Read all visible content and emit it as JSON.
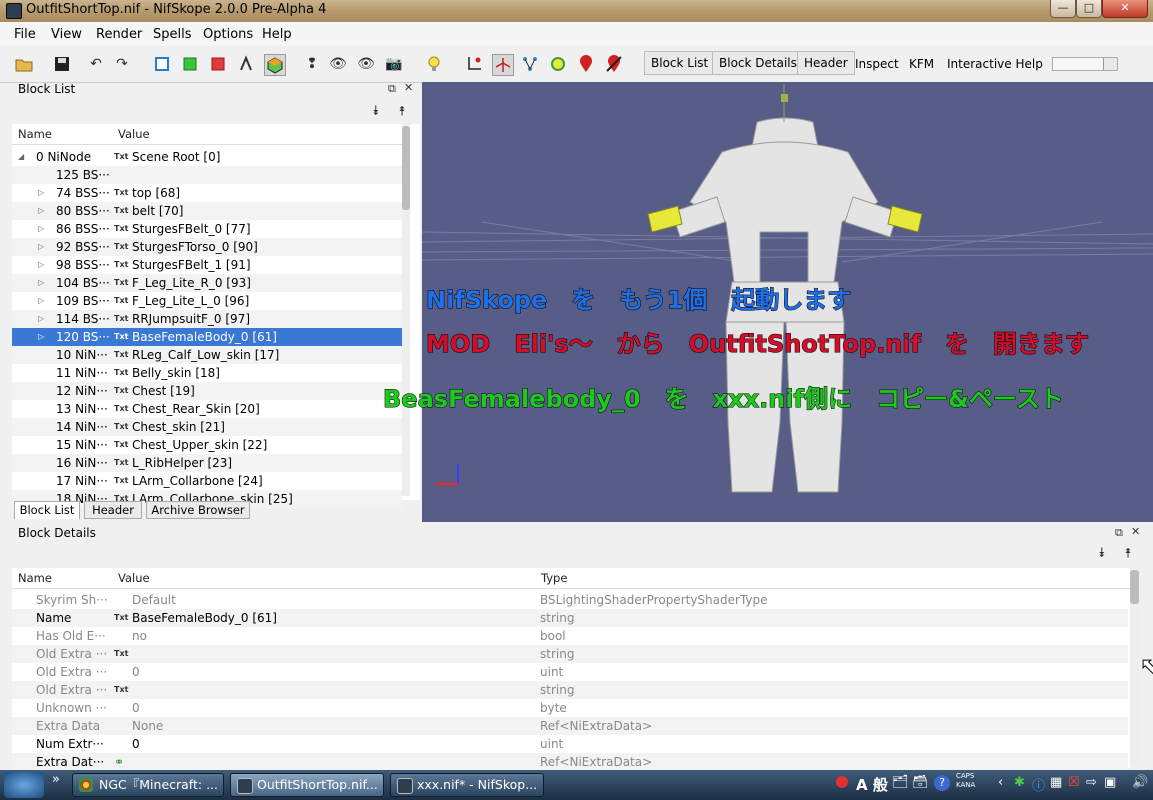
{
  "window": {
    "title": "OutfitShortTop.nif - NifSkope 2.0.0 Pre-Alpha 4",
    "minimize": "—",
    "maximize": "□",
    "close": "✕"
  },
  "menu": [
    "File",
    "View",
    "Render",
    "Spells",
    "Options",
    "Help"
  ],
  "toolbar": {
    "buttons": [
      "Block List",
      "Block Details",
      "Header",
      "Inspect",
      "KFM",
      "Interactive Help"
    ]
  },
  "block_list": {
    "title": "Block List",
    "columns": [
      "Name",
      "Value"
    ],
    "rows": [
      {
        "name": "0 NiNode",
        "value": "Scene Root [0]",
        "txt": true,
        "arrow": "◢"
      },
      {
        "name": "125 BS···",
        "value": "",
        "txt": false,
        "arrow": ""
      },
      {
        "name": "74 BSS···",
        "value": "top [68]",
        "txt": true,
        "arrow": "▷"
      },
      {
        "name": "80 BSS···",
        "value": "belt [70]",
        "txt": true,
        "arrow": "▷"
      },
      {
        "name": "86 BSS···",
        "value": "SturgesFBelt_0 [77]",
        "txt": true,
        "arrow": "▷"
      },
      {
        "name": "92 BSS···",
        "value": "SturgesFTorso_0 [90]",
        "txt": true,
        "arrow": "▷"
      },
      {
        "name": "98 BSS···",
        "value": "SturgesFBelt_1 [91]",
        "txt": true,
        "arrow": "▷"
      },
      {
        "name": "104 BS···",
        "value": "F_Leg_Lite_R_0 [93]",
        "txt": true,
        "arrow": "▷"
      },
      {
        "name": "109 BS···",
        "value": "F_Leg_Lite_L_0 [96]",
        "txt": true,
        "arrow": "▷"
      },
      {
        "name": "114 BS···",
        "value": "RRJumpsuitF_0 [97]",
        "txt": true,
        "arrow": "▷"
      },
      {
        "name": "120 BS···",
        "value": "BaseFemaleBody_0 [61]",
        "txt": true,
        "arrow": "▷"
      },
      {
        "name": "10 NiN···",
        "value": "RLeg_Calf_Low_skin [17]",
        "txt": true,
        "arrow": ""
      },
      {
        "name": "11 NiN···",
        "value": "Belly_skin [18]",
        "txt": true,
        "arrow": ""
      },
      {
        "name": "12 NiN···",
        "value": "Chest [19]",
        "txt": true,
        "arrow": ""
      },
      {
        "name": "13 NiN···",
        "value": "Chest_Rear_Skin [20]",
        "txt": true,
        "arrow": ""
      },
      {
        "name": "14 NiN···",
        "value": "Chest_skin [21]",
        "txt": true,
        "arrow": ""
      },
      {
        "name": "15 NiN···",
        "value": "Chest_Upper_skin [22]",
        "txt": true,
        "arrow": ""
      },
      {
        "name": "16 NiN···",
        "value": "L_RibHelper [23]",
        "txt": true,
        "arrow": ""
      },
      {
        "name": "17 NiN···",
        "value": "LArm_Collarbone [24]",
        "txt": true,
        "arrow": ""
      },
      {
        "name": "18 NiN···",
        "value": "LArm_Collarbone_skin [25]",
        "txt": true,
        "arrow": ""
      }
    ],
    "selected_index": 10,
    "tabs": [
      "Block List",
      "Header",
      "Archive Browser"
    ]
  },
  "overlay": {
    "line1": "NifSkope　を　もう1個　起動します",
    "line2": "MOD　Eli's～　から　OutfitShotTop.nif　を　開きます",
    "line3": "BeasFemalebody_0　を　xxx.nif側に　コピー&ペースト",
    "colors": {
      "line1": "#1e6fe8",
      "line2": "#d0102a",
      "line3": "#1ec81e"
    }
  },
  "block_details": {
    "title": "Block Details",
    "columns": [
      "Name",
      "Value",
      "Type"
    ],
    "rows": [
      {
        "name": "Skyrim Sh···",
        "value": "Default",
        "type": "BSLightingShaderPropertyShaderType",
        "txt": false,
        "gray": true
      },
      {
        "name": "Name",
        "value": "BaseFemaleBody_0 [61]",
        "type": "string",
        "txt": true,
        "gray": false
      },
      {
        "name": "Has Old E···",
        "value": "no",
        "type": "bool",
        "txt": false,
        "gray": true
      },
      {
        "name": "Old Extra ···",
        "value": "",
        "type": "string",
        "txt": true,
        "gray": true
      },
      {
        "name": "Old Extra ···",
        "value": "0",
        "type": "uint",
        "txt": false,
        "gray": true
      },
      {
        "name": "Old Extra ···",
        "value": "",
        "type": "string",
        "txt": true,
        "gray": true
      },
      {
        "name": "Unknown ···",
        "value": "0",
        "type": "byte",
        "txt": false,
        "gray": true
      },
      {
        "name": "Extra Data",
        "value": "None",
        "type": "Ref<NiExtraData>",
        "txt": false,
        "gray": true
      },
      {
        "name": "Num Extr···",
        "value": "0",
        "type": "uint",
        "txt": false,
        "gray": false
      },
      {
        "name": "Extra Dat···",
        "value": "",
        "type": "Ref<NiExtraData>",
        "txt": false,
        "gray": false
      }
    ]
  },
  "taskbar": {
    "tasks": [
      "NGC『Minecraft: ...",
      "OutfitShortTop.nif...",
      "xxx.nif* - NifSkop..."
    ],
    "tray_text": "A 般",
    "caps": "CAPS",
    "kana": "KANA"
  }
}
